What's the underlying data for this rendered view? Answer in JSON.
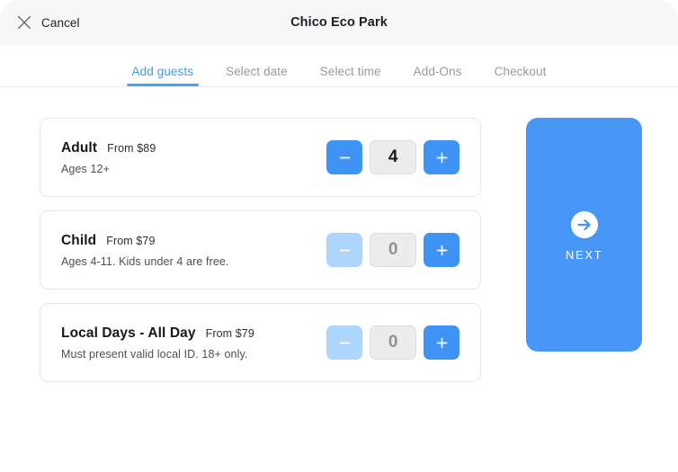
{
  "header": {
    "cancel_label": "Cancel",
    "close_icon": "close-icon",
    "title": "Chico Eco Park",
    "background": "#f7f7f8"
  },
  "tabs": {
    "active_index": 0,
    "accent_color": "#45a6f7",
    "inactive_color": "#9a9a9e",
    "items": [
      {
        "label": "Add guests"
      },
      {
        "label": "Select date"
      },
      {
        "label": "Select time"
      },
      {
        "label": "Add-Ons"
      },
      {
        "label": "Checkout"
      }
    ]
  },
  "tickets": [
    {
      "title": "Adult",
      "price": "From $89",
      "subtitle": "Ages 12+",
      "quantity": "4",
      "minus_enabled": true,
      "plus_enabled": true
    },
    {
      "title": "Child",
      "price": "From $79",
      "subtitle": "Ages 4-11. Kids under 4 are free.",
      "quantity": "0",
      "minus_enabled": false,
      "plus_enabled": true
    },
    {
      "title": "Local Days - All Day",
      "price": "From $79",
      "subtitle": "Must present valid local ID. 18+ only.",
      "quantity": "0",
      "minus_enabled": false,
      "plus_enabled": true
    }
  ],
  "next_button": {
    "label": "NEXT",
    "icon": "arrow-right-circle-icon",
    "color": "#4897f6"
  },
  "stepper": {
    "minus_icon": "minus-icon",
    "plus_icon": "plus-icon",
    "enabled_color": "#3f93f5",
    "disabled_color": "#aed5fb"
  }
}
